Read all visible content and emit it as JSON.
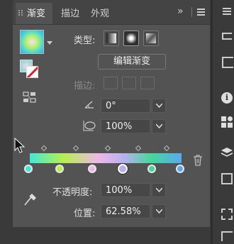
{
  "tabs": [
    {
      "label": "渐变",
      "active": true
    },
    {
      "label": "描边",
      "active": false
    },
    {
      "label": "外观",
      "active": false
    }
  ],
  "panel_overflow": "»",
  "type_label": "类型:",
  "edit_gradient_label": "编辑渐变",
  "stroke_label": "描边:",
  "angle": {
    "value": "0°"
  },
  "aspect_ratio": {
    "value": "100%"
  },
  "opacity": {
    "label": "不透明度:",
    "value": "100%"
  },
  "location": {
    "label": "位置:",
    "value": "62.58%"
  },
  "gradient": {
    "colors": [
      "#44e6d8",
      "#b4f04e",
      "#eeb8e6",
      "#b8b0ee",
      "#46d69a",
      "#5aa8f0"
    ],
    "selected_stop_index": 3
  },
  "icons": {
    "angle": "angle-icon",
    "aspect": "aspect-ratio-icon",
    "delete": "trash-icon",
    "eyedropper": "eyedropper-icon",
    "reverse": "reverse-gradient-icon",
    "menu": "panel-menu-icon"
  }
}
